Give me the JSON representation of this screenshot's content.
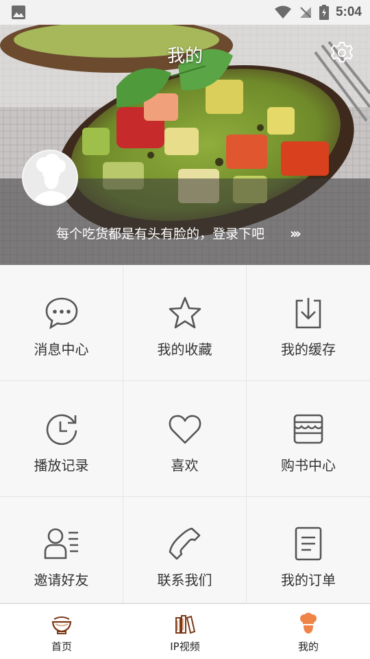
{
  "status_bar": {
    "time": "5:04"
  },
  "header": {
    "title": "我的",
    "login_prompt": "每个吃货都是有头有脸的，登录下吧"
  },
  "grid": {
    "items": [
      {
        "label": "消息中心",
        "icon": "chat-bubble-icon"
      },
      {
        "label": "我的收藏",
        "icon": "star-icon"
      },
      {
        "label": "我的缓存",
        "icon": "download-icon"
      },
      {
        "label": "播放记录",
        "icon": "history-clock-icon"
      },
      {
        "label": "喜欢",
        "icon": "heart-icon"
      },
      {
        "label": "购书中心",
        "icon": "store-icon"
      },
      {
        "label": "邀请好友",
        "icon": "invite-contact-icon"
      },
      {
        "label": "联系我们",
        "icon": "phone-icon"
      },
      {
        "label": "我的订单",
        "icon": "order-document-icon"
      }
    ]
  },
  "bottom_nav": {
    "items": [
      {
        "label": "首页",
        "icon": "bowl-icon",
        "active": false
      },
      {
        "label": "IP视频",
        "icon": "books-icon",
        "active": false
      },
      {
        "label": "我的",
        "icon": "chef-icon",
        "active": true
      }
    ]
  },
  "colors": {
    "accent": "#ef8449",
    "icon_gray": "#555555"
  }
}
